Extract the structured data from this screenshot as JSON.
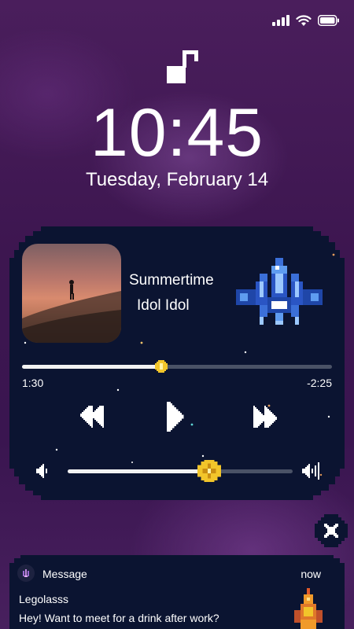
{
  "status_bar": {
    "signal_icon": "cellular-signal-icon",
    "wifi_icon": "wifi-icon",
    "battery_icon": "battery-icon"
  },
  "lock_screen": {
    "lock_icon": "unlocked-padlock-icon",
    "time": "10:45",
    "date": "Tuesday, February 14"
  },
  "now_playing": {
    "song_title": "Summertime",
    "artist": "Idol Idol",
    "elapsed": "1:30",
    "remaining": "-2:25",
    "progress_fraction": 0.45,
    "volume_fraction": 0.63,
    "controls": {
      "previous_icon": "rewind-icon",
      "play_icon": "play-icon",
      "next_icon": "fast-forward-icon"
    },
    "album_art": "album-art-silhouette-on-dune",
    "decoration": "pixel-spaceship-icon",
    "colors": {
      "panel": "#0b1431",
      "track": "#4a5266",
      "knob": "#f2c52a"
    }
  },
  "close_button": {
    "icon": "close-x-icon"
  },
  "notification": {
    "app_name": "Message",
    "time": "now",
    "sender": "Legolasss",
    "body": "Hey! Want to meet for a drink after work?"
  }
}
